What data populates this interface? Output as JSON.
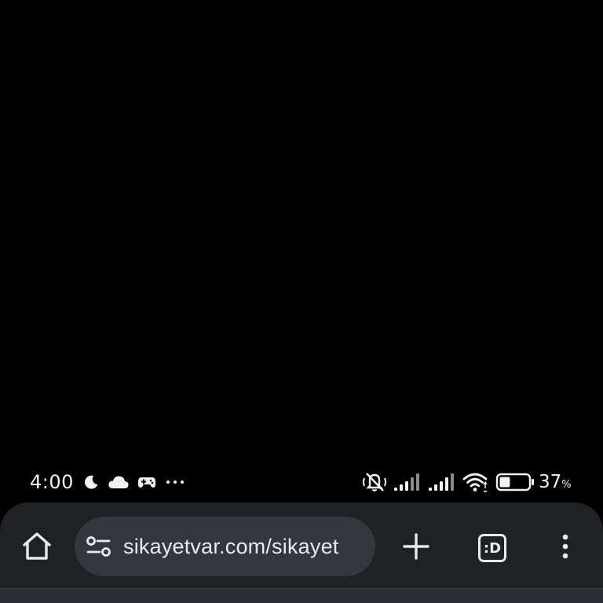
{
  "status_bar": {
    "time": "4:00",
    "battery_percent": "37",
    "battery_percent_sign": "%",
    "battery_level": 0.37,
    "notification_icons": [
      "moon-icon",
      "cloud-icon",
      "gamepad-icon",
      "more-dots-icon"
    ],
    "system_icons": [
      "vibrate-off-icon",
      "signal-icon",
      "signal-icon",
      "wifi-icon",
      "battery-icon"
    ]
  },
  "browser_toolbar": {
    "url": "sikayetvar.com/sikayet",
    "tabs_label": ":D",
    "icons": {
      "home": "home-icon",
      "site_settings": "tune-icon",
      "new_tab": "plus-icon",
      "tabs": "tab-switcher-icon",
      "menu": "more-vert-icon"
    }
  },
  "colors": {
    "background": "#000000",
    "toolbar": "#1f2125",
    "omnibox": "#35373d",
    "text": "#e8eaed"
  }
}
